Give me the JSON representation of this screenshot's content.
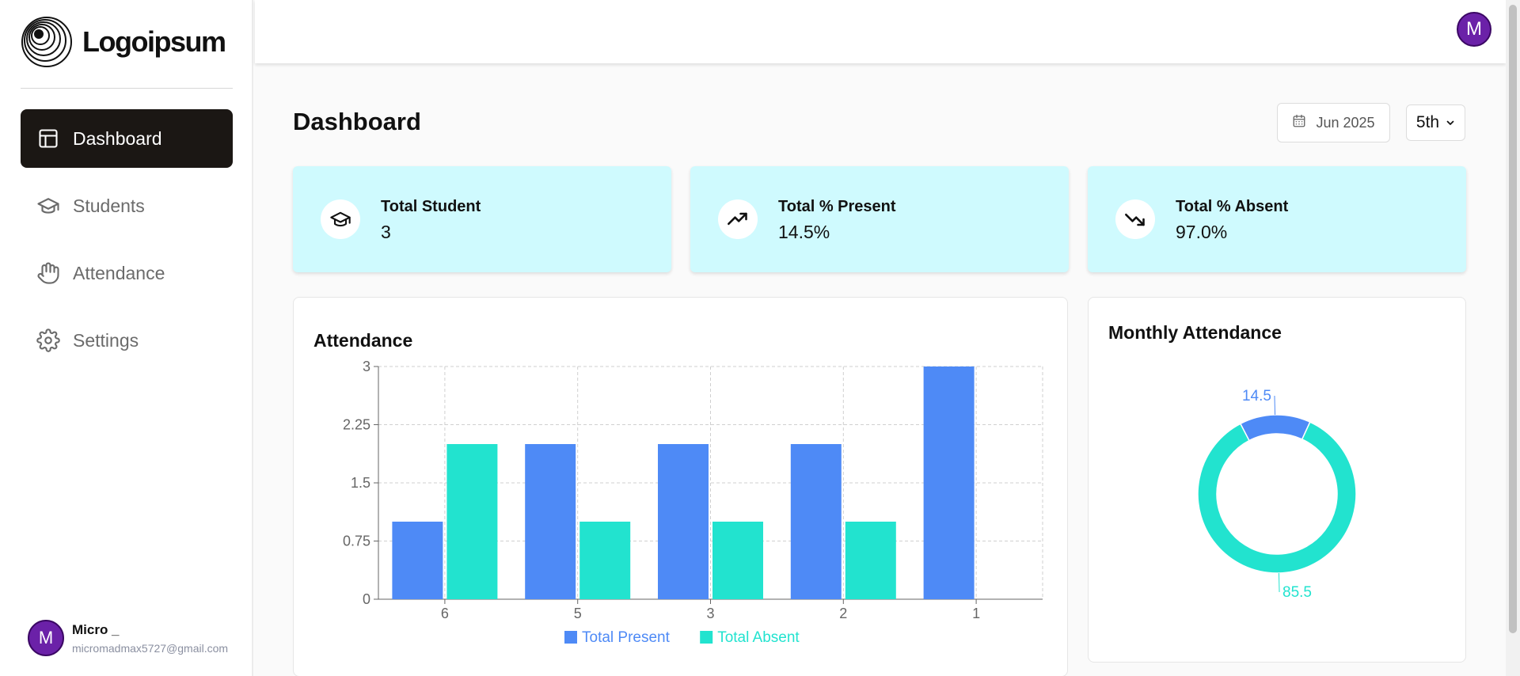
{
  "brand": {
    "name": "Logoipsum"
  },
  "sidebar": {
    "items": [
      {
        "label": "Dashboard",
        "icon": "dashboard-layout-icon",
        "active": true
      },
      {
        "label": "Students",
        "icon": "graduation-cap-icon",
        "active": false
      },
      {
        "label": "Attendance",
        "icon": "hand-icon",
        "active": false
      },
      {
        "label": "Settings",
        "icon": "gear-icon",
        "active": false
      }
    ],
    "user": {
      "initial": "M",
      "name": "Micro _",
      "email": "micromadmax5727@gmail.com"
    }
  },
  "header": {
    "avatar_initial": "M"
  },
  "page": {
    "title": "Dashboard",
    "month": "Jun 2025",
    "day": "5th"
  },
  "stats": [
    {
      "label": "Total Student",
      "value": "3",
      "icon": "graduation-cap-icon"
    },
    {
      "label": "Total % Present",
      "value": "14.5%",
      "icon": "trending-up-icon"
    },
    {
      "label": "Total % Absent",
      "value": "97.0%",
      "icon": "trending-down-icon"
    }
  ],
  "colors": {
    "present": "#4e8af6",
    "absent": "#22e3cf",
    "card_bg": "#cffafe",
    "active_nav": "#1b1714",
    "avatar": "#6b21a8"
  },
  "chart_data": [
    {
      "type": "bar",
      "title": "Attendance",
      "categories": [
        "6",
        "5",
        "3",
        "2",
        "1"
      ],
      "series": [
        {
          "name": "Total Present",
          "values": [
            1,
            2,
            2,
            2,
            3
          ]
        },
        {
          "name": "Total Absent",
          "values": [
            2,
            1,
            1,
            1,
            0
          ]
        }
      ],
      "yticks": [
        "0",
        "0.75",
        "1.5",
        "2.25",
        "3"
      ],
      "ylim": [
        0,
        3
      ],
      "grid": true,
      "legend": "bottom"
    },
    {
      "type": "pie",
      "title": "Monthly Attendance",
      "donut": true,
      "slices": [
        {
          "label": "14.5",
          "value": 14.5
        },
        {
          "label": "85.5",
          "value": 85.5
        }
      ]
    }
  ]
}
